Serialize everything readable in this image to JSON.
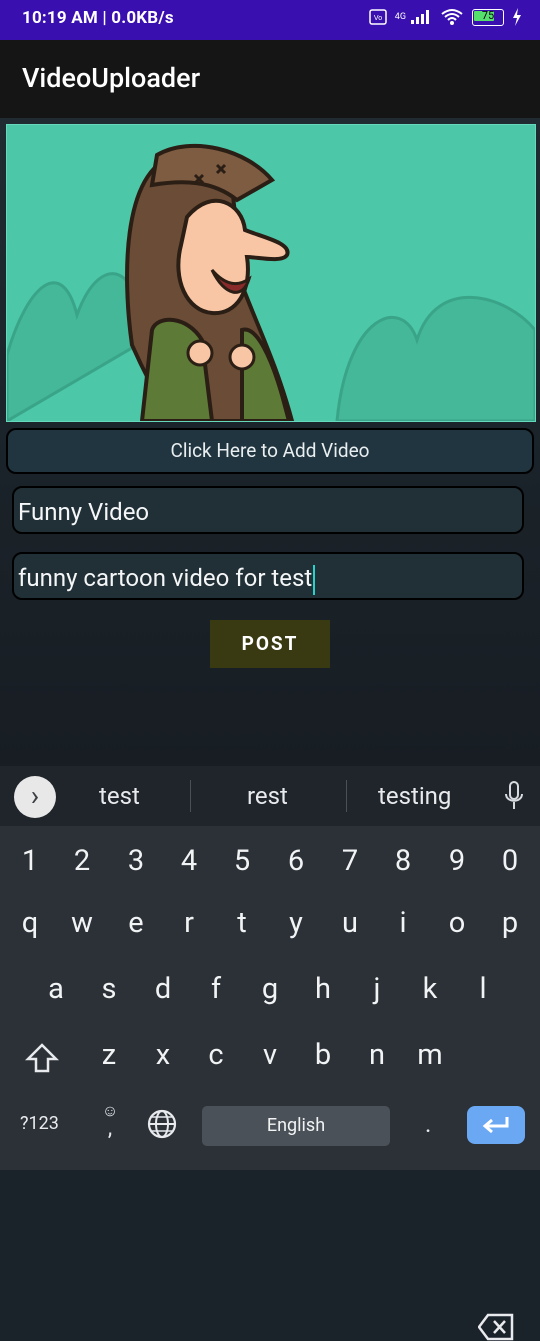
{
  "status": {
    "time": "10:19 AM | 0.0KB/s",
    "battery": "75",
    "network": "4G"
  },
  "app": {
    "title": "VideoUploader"
  },
  "form": {
    "add_video_label": "Click Here to Add Video",
    "title_value": "Funny Video",
    "description_value": "funny cartoon video for test",
    "post_label": "POST"
  },
  "keyboard": {
    "suggestions": [
      "test",
      "rest",
      "testing"
    ],
    "numbers": [
      "1",
      "2",
      "3",
      "4",
      "5",
      "6",
      "7",
      "8",
      "9",
      "0"
    ],
    "row1": [
      "q",
      "w",
      "e",
      "r",
      "t",
      "y",
      "u",
      "i",
      "o",
      "p"
    ],
    "row2": [
      "a",
      "s",
      "d",
      "f",
      "g",
      "h",
      "j",
      "k",
      "l"
    ],
    "row3": [
      "z",
      "x",
      "c",
      "v",
      "b",
      "n",
      "m"
    ],
    "symbols_label": "?123",
    "comma_label": ",",
    "space_label": "English",
    "period_label": "."
  },
  "colors": {
    "status_bar": "#3a0fb0",
    "app_bar": "#151515",
    "preview_background": "#49c7a7",
    "cursor": "#29d2c8",
    "post_button": "#3a3a12",
    "enter_key": "#6aa8f3"
  }
}
